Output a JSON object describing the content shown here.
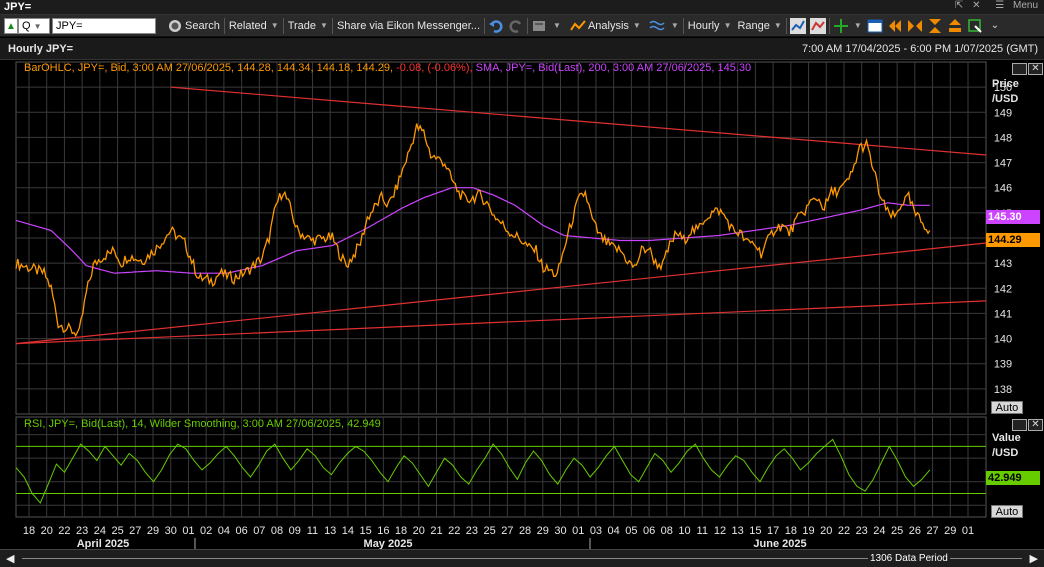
{
  "window": {
    "title": "JPY=",
    "controls": {
      "pin": "⇱",
      "close": "✕",
      "menu_label": "Menu"
    }
  },
  "toolbar": {
    "ric_type": "Q",
    "ric_value": "JPY=",
    "search_label": "Search",
    "related_label": "Related",
    "trade_label": "Trade",
    "share_label": "Share via Eikon Messenger...",
    "analysis_label": "Analysis",
    "interval_label": "Hourly",
    "range_label": "Range"
  },
  "header": {
    "title": "Hourly JPY=",
    "date_range": "7:00 AM 17/04/2025 - 6:00 PM 1/07/2025 (GMT)"
  },
  "price_panel": {
    "legend_main": "BarOHLC, JPY=, Bid, 3:00 AM 27/06/2025, 144.28, 144.34, 144.18, 144.29,",
    "legend_change": "-0.08, (-0.06%),",
    "legend_sma": "SMA, JPY=, Bid(Last), 200, 3:00 AM 27/06/2025, 145.30",
    "axis_title_line1": "Price",
    "axis_title_line2": "/USD",
    "last_price_tag": "144.29",
    "sma_tag": "145.30",
    "auto_label": "Auto"
  },
  "rsi_panel": {
    "legend": "RSI, JPY=, Bid(Last), 14, Wilder Smoothing, 3:00 AM 27/06/2025, 42.949",
    "axis_title_line1": "Value",
    "axis_title_line2": "/USD",
    "value_tag": "42.949",
    "auto_label": "Auto"
  },
  "footer": {
    "data_period": "1306 Data Period"
  },
  "colors": {
    "price": "#ff9900",
    "sma": "#cc44ff",
    "trendline": "#e03030",
    "rsi": "#66cc00",
    "grid": "#3a3a3a"
  },
  "chart_data": [
    {
      "type": "line",
      "panel": "price",
      "ylim": [
        137,
        151
      ],
      "yticks": [
        138,
        139,
        140,
        141,
        142,
        143,
        144,
        145,
        146,
        147,
        148,
        149,
        150
      ],
      "x_day_labels": [
        "18",
        "20",
        "22",
        "23",
        "24",
        "25",
        "27",
        "29",
        "30",
        "01",
        "02",
        "04",
        "06",
        "07",
        "08",
        "09",
        "11",
        "13",
        "14",
        "15",
        "16",
        "18",
        "20",
        "21",
        "22",
        "23",
        "25",
        "27",
        "28",
        "29",
        "30",
        "01",
        "03",
        "04",
        "05",
        "06",
        "08",
        "10",
        "11",
        "12",
        "13",
        "15",
        "17",
        "18",
        "19",
        "20",
        "22",
        "23",
        "24",
        "25",
        "26",
        "27",
        "29",
        "01"
      ],
      "x_month_labels": [
        "April 2025",
        "May 2025",
        "June 2025"
      ],
      "series": [
        {
          "name": "BarOHLC, JPY=, Bid",
          "points": [
            [
              0,
              143.0
            ],
            [
              2,
              142.8
            ],
            [
              4,
              142.6
            ],
            [
              5,
              142.0
            ],
            [
              6,
              140.6
            ],
            [
              8,
              140.3
            ],
            [
              9,
              140.2
            ],
            [
              10,
              141.8
            ],
            [
              11,
              142.9
            ],
            [
              12,
              143.2
            ],
            [
              14,
              143.5
            ],
            [
              15,
              143.0
            ],
            [
              16,
              143.3
            ],
            [
              18,
              143.1
            ],
            [
              20,
              143.6
            ],
            [
              22,
              144.3
            ],
            [
              24,
              143.8
            ],
            [
              25,
              143.1
            ],
            [
              26,
              142.4
            ],
            [
              28,
              142.3
            ],
            [
              29,
              142.6
            ],
            [
              31,
              142.4
            ],
            [
              33,
              142.7
            ],
            [
              35,
              143.2
            ],
            [
              36,
              144.0
            ],
            [
              37,
              145.3
            ],
            [
              38,
              145.9
            ],
            [
              39,
              145.2
            ],
            [
              40,
              144.3
            ],
            [
              42,
              143.9
            ],
            [
              44,
              144.0
            ],
            [
              45,
              144.0
            ],
            [
              46,
              143.4
            ],
            [
              47,
              142.9
            ],
            [
              48,
              143.3
            ],
            [
              49,
              143.8
            ],
            [
              50,
              144.8
            ],
            [
              52,
              145.6
            ],
            [
              53,
              145.3
            ],
            [
              54,
              145.9
            ],
            [
              55,
              146.7
            ],
            [
              56,
              147.5
            ],
            [
              57,
              148.4
            ],
            [
              58,
              148.2
            ],
            [
              59,
              147.3
            ],
            [
              61,
              147.0
            ],
            [
              62,
              146.3
            ],
            [
              63,
              145.8
            ],
            [
              64,
              145.5
            ],
            [
              66,
              145.7
            ],
            [
              67,
              145.4
            ],
            [
              68,
              144.9
            ],
            [
              69,
              144.6
            ],
            [
              70,
              144.3
            ],
            [
              71,
              144.1
            ],
            [
              72,
              143.9
            ],
            [
              73,
              143.6
            ],
            [
              74,
              143.5
            ],
            [
              75,
              142.8
            ],
            [
              76,
              142.7
            ],
            [
              77,
              142.5
            ],
            [
              78,
              143.6
            ],
            [
              79,
              144.6
            ],
            [
              80,
              145.5
            ],
            [
              81,
              145.8
            ],
            [
              82,
              144.7
            ],
            [
              83,
              144.1
            ],
            [
              84,
              143.8
            ],
            [
              85,
              143.6
            ],
            [
              86,
              143.5
            ],
            [
              87,
              143.1
            ],
            [
              88,
              142.8
            ],
            [
              89,
              143.5
            ],
            [
              90,
              143.6
            ],
            [
              91,
              143.0
            ],
            [
              92,
              142.9
            ],
            [
              93,
              143.7
            ],
            [
              94,
              144.2
            ],
            [
              95,
              143.9
            ],
            [
              96,
              144.3
            ],
            [
              97,
              144.3
            ],
            [
              98,
              144.8
            ],
            [
              99,
              145.0
            ],
            [
              100,
              145.1
            ],
            [
              101,
              144.8
            ],
            [
              102,
              144.3
            ],
            [
              103,
              144.2
            ],
            [
              104,
              143.8
            ],
            [
              105,
              143.8
            ],
            [
              106,
              143.4
            ],
            [
              107,
              143.9
            ],
            [
              108,
              144.4
            ],
            [
              109,
              144.5
            ],
            [
              110,
              144.2
            ],
            [
              111,
              144.7
            ],
            [
              112,
              145.0
            ],
            [
              113,
              145.4
            ],
            [
              114,
              145.6
            ],
            [
              115,
              145.2
            ],
            [
              116,
              145.8
            ],
            [
              117,
              145.9
            ],
            [
              118,
              146.1
            ],
            [
              119,
              146.6
            ],
            [
              120,
              147.6
            ],
            [
              121,
              147.7
            ],
            [
              122,
              146.7
            ],
            [
              123,
              145.6
            ],
            [
              124,
              145.0
            ],
            [
              125,
              144.8
            ],
            [
              126,
              145.4
            ],
            [
              127,
              145.6
            ],
            [
              128,
              144.9
            ],
            [
              129,
              144.6
            ],
            [
              130,
              144.3
            ]
          ]
        },
        {
          "name": "SMA, JPY=, Bid(Last), 200",
          "points": [
            [
              0,
              144.7
            ],
            [
              5,
              144.3
            ],
            [
              8,
              143.5
            ],
            [
              10,
              142.9
            ],
            [
              14,
              142.6
            ],
            [
              20,
              142.7
            ],
            [
              25,
              142.6
            ],
            [
              30,
              142.6
            ],
            [
              35,
              142.9
            ],
            [
              40,
              143.5
            ],
            [
              45,
              143.7
            ],
            [
              50,
              144.4
            ],
            [
              55,
              145.2
            ],
            [
              58,
              145.6
            ],
            [
              60,
              145.8
            ],
            [
              62,
              146.0
            ],
            [
              65,
              146.0
            ],
            [
              68,
              145.7
            ],
            [
              71,
              145.3
            ],
            [
              75,
              144.5
            ],
            [
              78,
              144.1
            ],
            [
              82,
              144.0
            ],
            [
              86,
              143.9
            ],
            [
              90,
              143.9
            ],
            [
              95,
              144.0
            ],
            [
              100,
              144.1
            ],
            [
              105,
              144.3
            ],
            [
              110,
              144.5
            ],
            [
              115,
              144.8
            ],
            [
              120,
              145.1
            ],
            [
              124,
              145.4
            ],
            [
              127,
              145.3
            ],
            [
              130,
              145.3
            ]
          ]
        }
      ],
      "trendlines": [
        {
          "name": "upper-resistance",
          "from": [
            22,
            150.0
          ],
          "to": [
            138,
            147.3
          ]
        },
        {
          "name": "lower-support",
          "from": [
            0,
            139.8
          ],
          "to": [
            138,
            143.8
          ]
        },
        {
          "name": "lower-support-2",
          "from": [
            0,
            139.8
          ],
          "to": [
            138,
            141.5
          ]
        }
      ]
    },
    {
      "type": "line",
      "panel": "rsi",
      "ylim": [
        10,
        95
      ],
      "reference_lines": [
        70,
        30
      ],
      "series": [
        {
          "name": "RSI, JPY=, Bid(Last), 14, Wilder Smoothing",
          "values": [
            52,
            44,
            30,
            22,
            38,
            55,
            48,
            60,
            72,
            66,
            58,
            70,
            62,
            54,
            64,
            58,
            48,
            40,
            50,
            63,
            72,
            68,
            58,
            50,
            56,
            64,
            70,
            62,
            52,
            44,
            54,
            66,
            72,
            60,
            50,
            58,
            68,
            62,
            52,
            46,
            56,
            64,
            70,
            66,
            58,
            48,
            40,
            52,
            62,
            56,
            46,
            36,
            48,
            60,
            54,
            44,
            38,
            50,
            60,
            72,
            64,
            52,
            42,
            56,
            66,
            58,
            46,
            38,
            50,
            60,
            54,
            44,
            52,
            62,
            70,
            58,
            46,
            40,
            52,
            64,
            58,
            48,
            56,
            66,
            72,
            60,
            50,
            44,
            54,
            62,
            58,
            48,
            40,
            52,
            62,
            68,
            60,
            50,
            56,
            64,
            70,
            76,
            62,
            46,
            36,
            32,
            42,
            56,
            70,
            58,
            44,
            36,
            42,
            50
          ]
        }
      ]
    }
  ]
}
